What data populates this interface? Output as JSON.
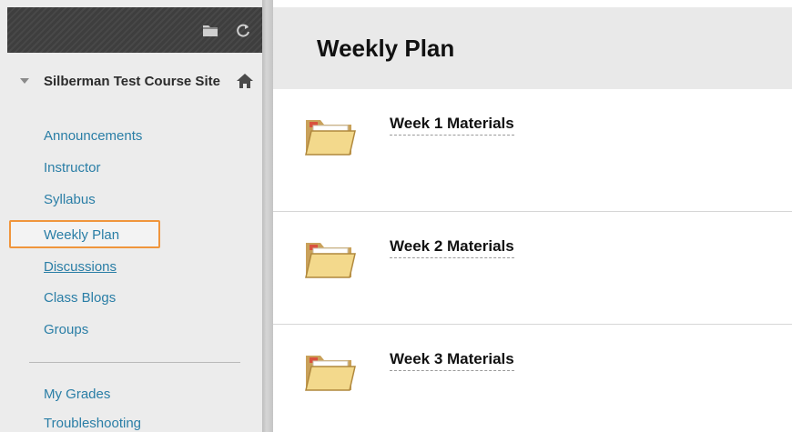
{
  "sidebar": {
    "course_title": "Silberman Test Course Site",
    "items": [
      {
        "label": "Announcements"
      },
      {
        "label": "Instructor"
      },
      {
        "label": "Syllabus"
      },
      {
        "label": "Weekly Plan",
        "active": true
      },
      {
        "label": "Discussions"
      },
      {
        "label": "Class Blogs"
      },
      {
        "label": "Groups"
      },
      {
        "label": "My Grades"
      },
      {
        "label": "Troubleshooting"
      }
    ],
    "icons": [
      "folder-icon",
      "refresh-icon",
      "home-icon",
      "collapse-triangle-icon"
    ]
  },
  "main": {
    "title": "Weekly Plan",
    "items": [
      {
        "title": "Week 1 Materials",
        "icon": "folder-icon"
      },
      {
        "title": "Week 2 Materials",
        "icon": "folder-icon"
      },
      {
        "title": "Week 3 Materials",
        "icon": "folder-icon"
      }
    ]
  },
  "colors": {
    "link": "#2a7ea6",
    "highlight_border": "#f0953c",
    "sidebar_bg": "#ececec",
    "header_bg": "#e9e9e9"
  }
}
